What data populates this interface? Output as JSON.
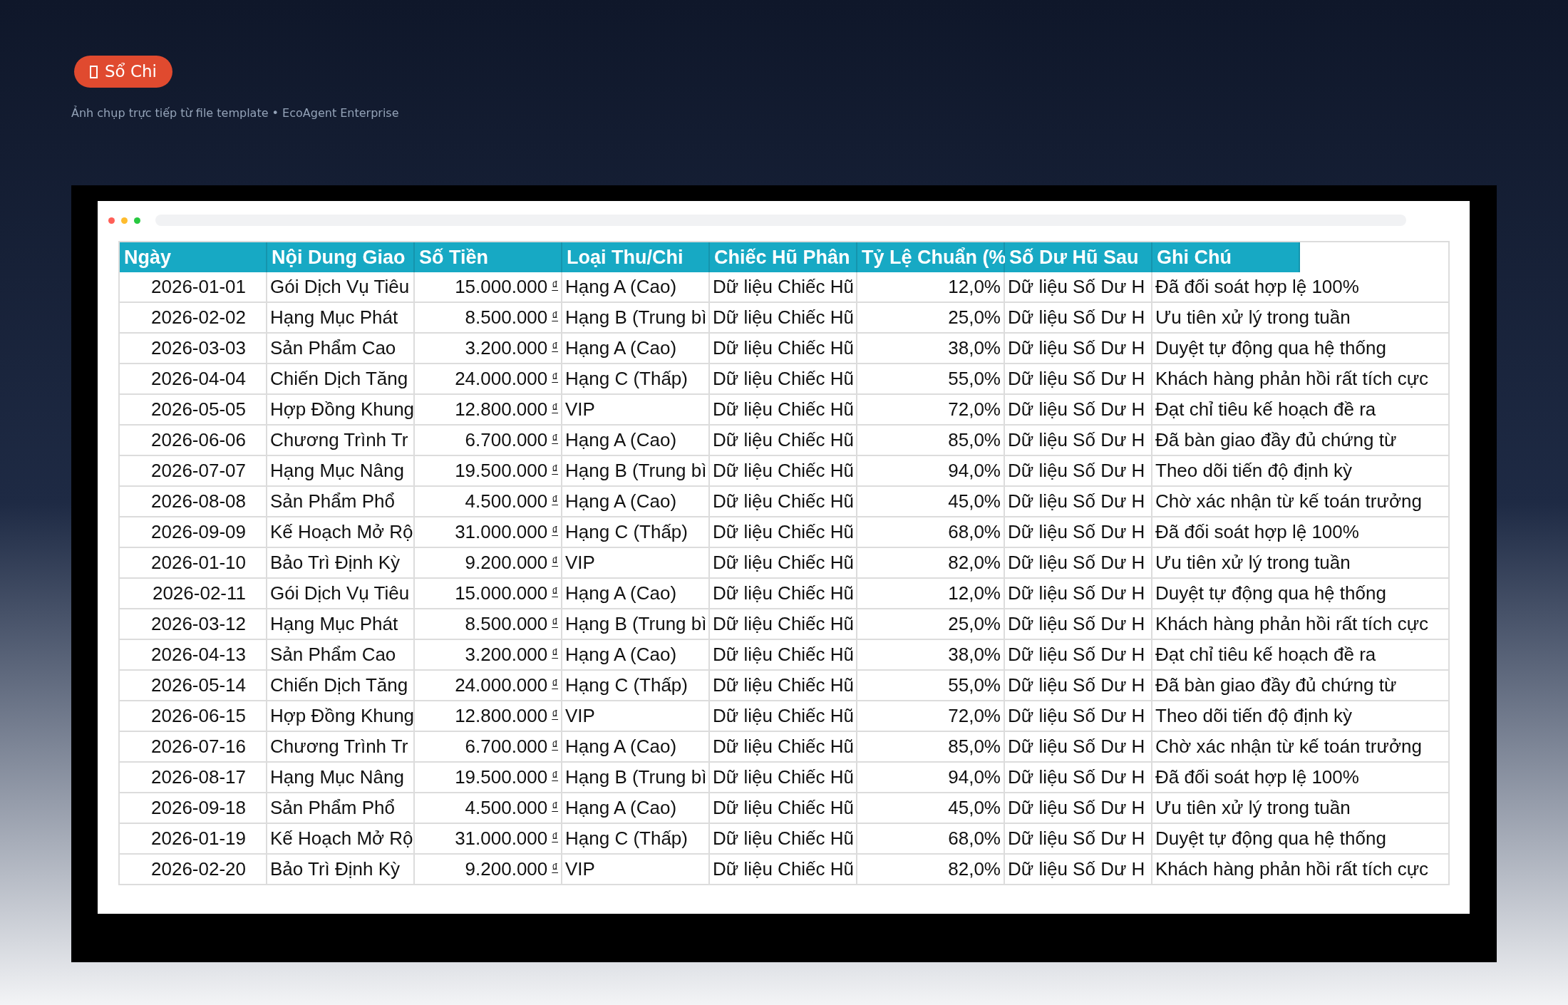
{
  "badge": {
    "label": "Sổ Chi"
  },
  "caption": "Ảnh chụp trực tiếp từ file template • EcoAgent Enterprise",
  "table": {
    "columns": [
      "Ngày",
      "Nội Dung Giao",
      "Số Tiền",
      "Loại Thu/Chi",
      "Chiếc Hũ Phân",
      "Tỷ Lệ Chuẩn (%",
      "Số Dư Hũ Sau",
      "Ghi Chú"
    ],
    "rows": [
      {
        "date": "2026-01-01",
        "content": "Gói Dịch Vụ Tiêu",
        "amount": "15.000.000",
        "currency": "₫",
        "type": "Hạng A (Cao)",
        "jar": "Dữ liệu Chiếc Hũ",
        "rate": "12,0%",
        "balance": "Dữ liệu Số Dư H",
        "note": "Đã đối soát hợp lệ 100%"
      },
      {
        "date": "2026-02-02",
        "content": "Hạng Mục Phát",
        "amount": "8.500.000",
        "currency": "₫",
        "type": "Hạng B (Trung bì",
        "jar": "Dữ liệu Chiếc Hũ",
        "rate": "25,0%",
        "balance": "Dữ liệu Số Dư H",
        "note": "Ưu tiên xử lý trong tuần"
      },
      {
        "date": "2026-03-03",
        "content": "Sản Phẩm Cao",
        "amount": "3.200.000",
        "currency": "₫",
        "type": "Hạng A (Cao)",
        "jar": "Dữ liệu Chiếc Hũ",
        "rate": "38,0%",
        "balance": "Dữ liệu Số Dư H",
        "note": "Duyệt tự động qua hệ thống"
      },
      {
        "date": "2026-04-04",
        "content": "Chiến Dịch Tăng",
        "amount": "24.000.000",
        "currency": "₫",
        "type": "Hạng C (Thấp)",
        "jar": "Dữ liệu Chiếc Hũ",
        "rate": "55,0%",
        "balance": "Dữ liệu Số Dư H",
        "note": "Khách hàng phản hồi rất tích cực"
      },
      {
        "date": "2026-05-05",
        "content": "Hợp Đồng Khung",
        "amount": "12.800.000",
        "currency": "₫",
        "type": "VIP",
        "jar": "Dữ liệu Chiếc Hũ",
        "rate": "72,0%",
        "balance": "Dữ liệu Số Dư H",
        "note": "Đạt chỉ tiêu kế hoạch đề ra"
      },
      {
        "date": "2026-06-06",
        "content": "Chương Trình Tr",
        "amount": "6.700.000",
        "currency": "₫",
        "type": "Hạng A (Cao)",
        "jar": "Dữ liệu Chiếc Hũ",
        "rate": "85,0%",
        "balance": "Dữ liệu Số Dư H",
        "note": "Đã bàn giao đầy đủ chứng từ"
      },
      {
        "date": "2026-07-07",
        "content": "Hạng Mục Nâng",
        "amount": "19.500.000",
        "currency": "₫",
        "type": "Hạng B (Trung bì",
        "jar": "Dữ liệu Chiếc Hũ",
        "rate": "94,0%",
        "balance": "Dữ liệu Số Dư H",
        "note": "Theo dõi tiến độ định kỳ"
      },
      {
        "date": "2026-08-08",
        "content": "Sản Phẩm Phổ",
        "amount": "4.500.000",
        "currency": "₫",
        "type": "Hạng A (Cao)",
        "jar": "Dữ liệu Chiếc Hũ",
        "rate": "45,0%",
        "balance": "Dữ liệu Số Dư H",
        "note": "Chờ xác nhận từ kế toán trưởng"
      },
      {
        "date": "2026-09-09",
        "content": "Kế Hoạch Mở Rộ",
        "amount": "31.000.000",
        "currency": "₫",
        "type": "Hạng C (Thấp)",
        "jar": "Dữ liệu Chiếc Hũ",
        "rate": "68,0%",
        "balance": "Dữ liệu Số Dư H",
        "note": "Đã đối soát hợp lệ 100%"
      },
      {
        "date": "2026-01-10",
        "content": "Bảo Trì Định Kỳ",
        "amount": "9.200.000",
        "currency": "₫",
        "type": "VIP",
        "jar": "Dữ liệu Chiếc Hũ",
        "rate": "82,0%",
        "balance": "Dữ liệu Số Dư H",
        "note": "Ưu tiên xử lý trong tuần"
      },
      {
        "date": "2026-02-11",
        "content": "Gói Dịch Vụ Tiêu",
        "amount": "15.000.000",
        "currency": "₫",
        "type": "Hạng A (Cao)",
        "jar": "Dữ liệu Chiếc Hũ",
        "rate": "12,0%",
        "balance": "Dữ liệu Số Dư H",
        "note": "Duyệt tự động qua hệ thống"
      },
      {
        "date": "2026-03-12",
        "content": "Hạng Mục Phát",
        "amount": "8.500.000",
        "currency": "₫",
        "type": "Hạng B (Trung bì",
        "jar": "Dữ liệu Chiếc Hũ",
        "rate": "25,0%",
        "balance": "Dữ liệu Số Dư H",
        "note": "Khách hàng phản hồi rất tích cực"
      },
      {
        "date": "2026-04-13",
        "content": "Sản Phẩm Cao",
        "amount": "3.200.000",
        "currency": "₫",
        "type": "Hạng A (Cao)",
        "jar": "Dữ liệu Chiếc Hũ",
        "rate": "38,0%",
        "balance": "Dữ liệu Số Dư H",
        "note": "Đạt chỉ tiêu kế hoạch đề ra"
      },
      {
        "date": "2026-05-14",
        "content": "Chiến Dịch Tăng",
        "amount": "24.000.000",
        "currency": "₫",
        "type": "Hạng C (Thấp)",
        "jar": "Dữ liệu Chiếc Hũ",
        "rate": "55,0%",
        "balance": "Dữ liệu Số Dư H",
        "note": "Đã bàn giao đầy đủ chứng từ"
      },
      {
        "date": "2026-06-15",
        "content": "Hợp Đồng Khung",
        "amount": "12.800.000",
        "currency": "₫",
        "type": "VIP",
        "jar": "Dữ liệu Chiếc Hũ",
        "rate": "72,0%",
        "balance": "Dữ liệu Số Dư H",
        "note": "Theo dõi tiến độ định kỳ"
      },
      {
        "date": "2026-07-16",
        "content": "Chương Trình Tr",
        "amount": "6.700.000",
        "currency": "₫",
        "type": "Hạng A (Cao)",
        "jar": "Dữ liệu Chiếc Hũ",
        "rate": "85,0%",
        "balance": "Dữ liệu Số Dư H",
        "note": "Chờ xác nhận từ kế toán trưởng"
      },
      {
        "date": "2026-08-17",
        "content": "Hạng Mục Nâng",
        "amount": "19.500.000",
        "currency": "₫",
        "type": "Hạng B (Trung bì",
        "jar": "Dữ liệu Chiếc Hũ",
        "rate": "94,0%",
        "balance": "Dữ liệu Số Dư H",
        "note": "Đã đối soát hợp lệ 100%"
      },
      {
        "date": "2026-09-18",
        "content": "Sản Phẩm Phổ",
        "amount": "4.500.000",
        "currency": "₫",
        "type": "Hạng A (Cao)",
        "jar": "Dữ liệu Chiếc Hũ",
        "rate": "45,0%",
        "balance": "Dữ liệu Số Dư H",
        "note": "Ưu tiên xử lý trong tuần"
      },
      {
        "date": "2026-01-19",
        "content": "Kế Hoạch Mở Rộ",
        "amount": "31.000.000",
        "currency": "₫",
        "type": "Hạng C (Thấp)",
        "jar": "Dữ liệu Chiếc Hũ",
        "rate": "68,0%",
        "balance": "Dữ liệu Số Dư H",
        "note": "Duyệt tự động qua hệ thống"
      },
      {
        "date": "2026-02-20",
        "content": "Bảo Trì Định Kỳ",
        "amount": "9.200.000",
        "currency": "₫",
        "type": "VIP",
        "jar": "Dữ liệu Chiếc Hũ",
        "rate": "82,0%",
        "balance": "Dữ liệu Số Dư H",
        "note": "Khách hàng phản hồi rất tích cực"
      }
    ]
  }
}
